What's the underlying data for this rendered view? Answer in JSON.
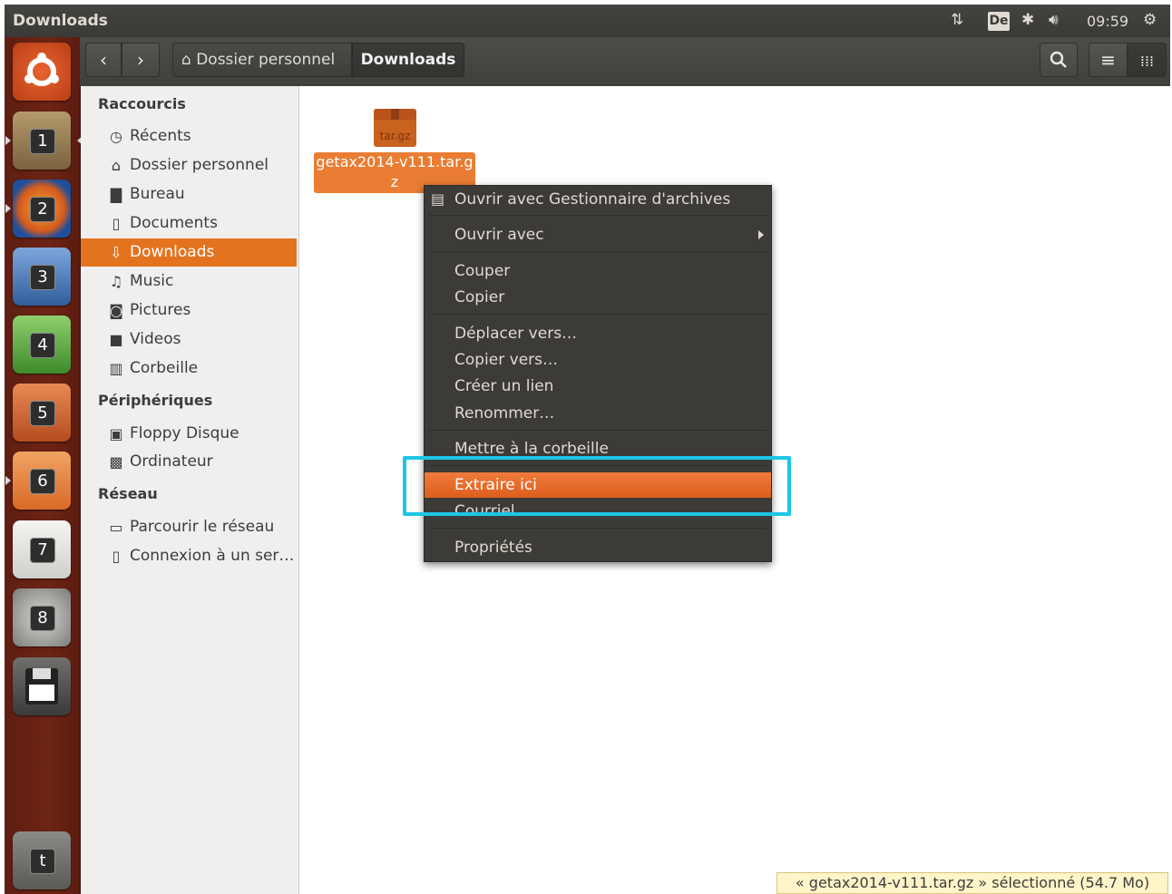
{
  "panel": {
    "window_title": "Downloads",
    "keyboard_layout": "De",
    "clock": "09:59"
  },
  "launcher": {
    "items": [
      {
        "icon": "ubuntu-dash-icon",
        "number": ""
      },
      {
        "icon": "files-icon",
        "number": "1"
      },
      {
        "icon": "firefox-icon",
        "number": "2"
      },
      {
        "icon": "libreoffice-writer-icon",
        "number": "3"
      },
      {
        "icon": "libreoffice-calc-icon",
        "number": "4"
      },
      {
        "icon": "libreoffice-impress-icon",
        "number": "5"
      },
      {
        "icon": "software-center-icon",
        "number": "6"
      },
      {
        "icon": "amazon-icon",
        "number": "7"
      },
      {
        "icon": "system-settings-icon",
        "number": "8"
      },
      {
        "icon": "floppy-drive-icon",
        "number": ""
      },
      {
        "icon": "trash-icon",
        "number": "t"
      }
    ]
  },
  "headerbar": {
    "breadcrumb_home": "Dossier personnel",
    "breadcrumb_current": "Downloads"
  },
  "sidebar": {
    "sections": [
      {
        "heading": "Raccourcis",
        "items": [
          {
            "label": "Récents",
            "icon": "clock-icon"
          },
          {
            "label": "Dossier personnel",
            "icon": "home-icon"
          },
          {
            "label": "Bureau",
            "icon": "folder-icon"
          },
          {
            "label": "Documents",
            "icon": "document-icon"
          },
          {
            "label": "Downloads",
            "icon": "download-icon",
            "active": true
          },
          {
            "label": "Music",
            "icon": "music-icon"
          },
          {
            "label": "Pictures",
            "icon": "camera-icon"
          },
          {
            "label": "Videos",
            "icon": "video-icon"
          },
          {
            "label": "Corbeille",
            "icon": "trash-icon"
          }
        ]
      },
      {
        "heading": "Périphériques",
        "items": [
          {
            "label": "Floppy Disque",
            "icon": "floppy-icon"
          },
          {
            "label": "Ordinateur",
            "icon": "computer-icon"
          }
        ]
      },
      {
        "heading": "Réseau",
        "items": [
          {
            "label": "Parcourir le réseau",
            "icon": "network-icon"
          },
          {
            "label": "Connexion à un ser…",
            "icon": "server-icon"
          }
        ]
      }
    ]
  },
  "file": {
    "name": "getax2014-v111.tar.gz",
    "icon_text": "tar.gz"
  },
  "context_menu": {
    "items": [
      {
        "label": "Ouvrir avec Gestionnaire d'archives"
      },
      {
        "label": "Ouvrir avec"
      },
      {
        "label": "Couper"
      },
      {
        "label": "Copier"
      },
      {
        "label": "Déplacer vers…"
      },
      {
        "label": "Copier vers…"
      },
      {
        "label": "Créer un lien"
      },
      {
        "label": "Renommer…"
      },
      {
        "label": "Mettre à la corbeille"
      },
      {
        "label": "Extraire ici"
      },
      {
        "label": "Courriel…"
      },
      {
        "label": "Propriétés"
      }
    ],
    "highlighted": "Extraire ici"
  },
  "status_bar": {
    "text": "« getax2014-v111.tar.gz » sélectionné  (54.7 Mo)"
  },
  "colors": {
    "accent": "#e3731f",
    "menu_bg": "#3c3b37",
    "annotation": "#1cc6e6"
  }
}
